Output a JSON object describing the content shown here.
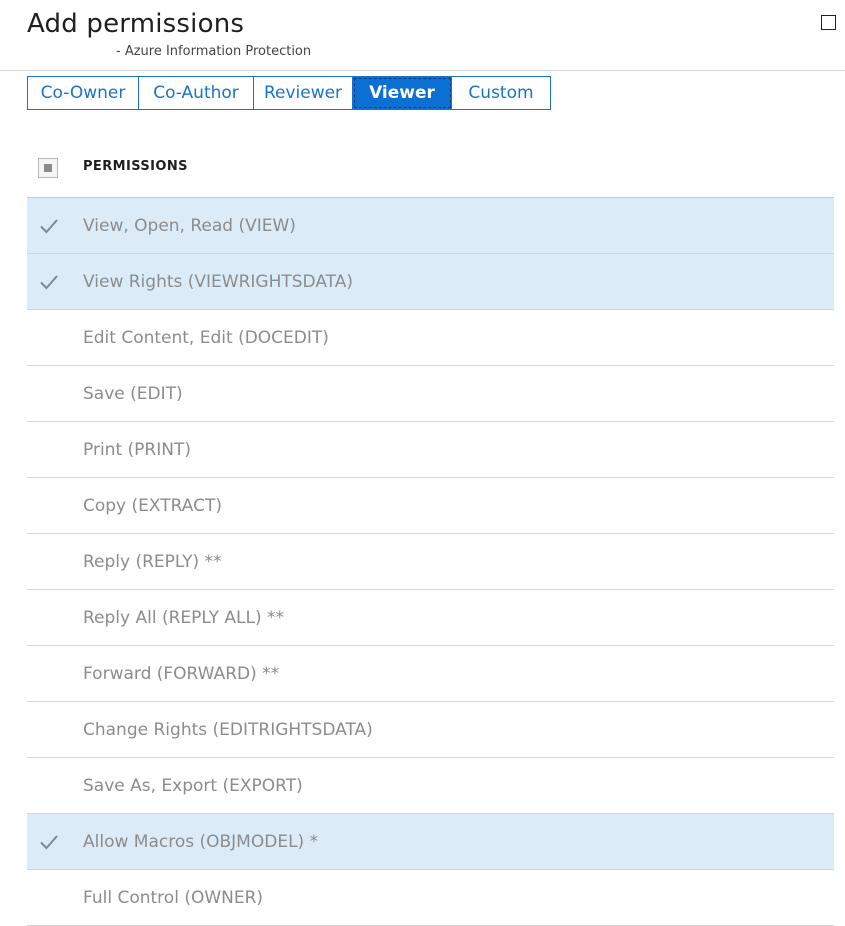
{
  "header": {
    "title": "Add permissions",
    "subtitle": "- Azure Information Protection",
    "maximize_icon": "maximize-square-icon"
  },
  "tabs": [
    {
      "label": "Co-Owner",
      "selected": false
    },
    {
      "label": "Co-Author",
      "selected": false
    },
    {
      "label": "Reviewer",
      "selected": false
    },
    {
      "label": "Viewer",
      "selected": true
    },
    {
      "label": "Custom",
      "selected": false
    }
  ],
  "list": {
    "header_label": "PERMISSIONS",
    "header_checkbox_state": "indeterminate",
    "items": [
      {
        "label": "View, Open, Read (VIEW)",
        "checked": true
      },
      {
        "label": "View Rights (VIEWRIGHTSDATA)",
        "checked": true
      },
      {
        "label": "Edit Content, Edit (DOCEDIT)",
        "checked": false
      },
      {
        "label": "Save (EDIT)",
        "checked": false
      },
      {
        "label": "Print (PRINT)",
        "checked": false
      },
      {
        "label": "Copy (EXTRACT)",
        "checked": false
      },
      {
        "label": "Reply (REPLY) **",
        "checked": false
      },
      {
        "label": "Reply All (REPLY ALL) **",
        "checked": false
      },
      {
        "label": "Forward (FORWARD) **",
        "checked": false
      },
      {
        "label": "Change Rights (EDITRIGHTSDATA)",
        "checked": false
      },
      {
        "label": "Save As, Export (EXPORT)",
        "checked": false
      },
      {
        "label": "Allow Macros (OBJMODEL) *",
        "checked": true
      },
      {
        "label": "Full Control (OWNER)",
        "checked": false
      }
    ]
  },
  "colors": {
    "accent": "#1a73c9",
    "selected_tab_bg": "#0b6fd3",
    "checked_row_bg": "#dcebf8",
    "disabled_text": "#8c8c8c"
  }
}
